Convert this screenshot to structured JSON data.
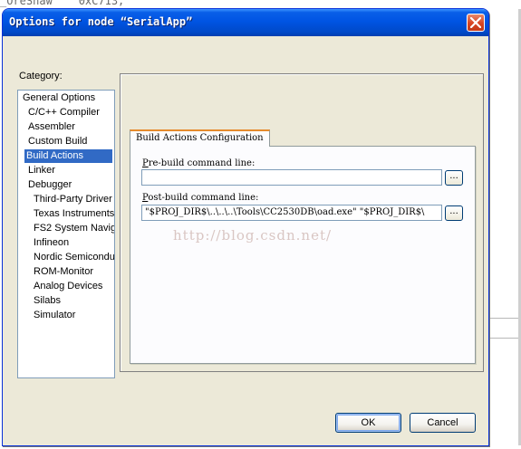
{
  "background": {
    "code_fragment": "_OreShaw    0xC713,"
  },
  "dialog": {
    "title": "Options for node “SerialApp”",
    "close_icon": "close-x-icon",
    "category_label": "Category:",
    "categories": [
      {
        "label": "General Options",
        "indent": 0,
        "selected": false
      },
      {
        "label": "C/C++ Compiler",
        "indent": 1,
        "selected": false
      },
      {
        "label": "Assembler",
        "indent": 1,
        "selected": false
      },
      {
        "label": "Custom Build",
        "indent": 1,
        "selected": false
      },
      {
        "label": "Build Actions",
        "indent": 1,
        "selected": true
      },
      {
        "label": "Linker",
        "indent": 1,
        "selected": false
      },
      {
        "label": "Debugger",
        "indent": 1,
        "selected": false
      },
      {
        "label": "Third-Party Driver",
        "indent": 2,
        "selected": false
      },
      {
        "label": "Texas Instruments",
        "indent": 2,
        "selected": false
      },
      {
        "label": "FS2 System Navig",
        "indent": 2,
        "selected": false
      },
      {
        "label": "Infineon",
        "indent": 2,
        "selected": false
      },
      {
        "label": "Nordic Semiconduc",
        "indent": 2,
        "selected": false
      },
      {
        "label": "ROM-Monitor",
        "indent": 2,
        "selected": false
      },
      {
        "label": "Analog Devices",
        "indent": 2,
        "selected": false
      },
      {
        "label": "Silabs",
        "indent": 2,
        "selected": false
      },
      {
        "label": "Simulator",
        "indent": 2,
        "selected": false
      }
    ],
    "tab_label": "Build Actions Configuration",
    "prebuild": {
      "label_accel": "P",
      "label_rest": "re-build command line:",
      "value": "",
      "browse_label": "..."
    },
    "postbuild": {
      "label_accel": "P",
      "label_rest": "ost-build command line:",
      "value": "\"$PROJ_DIR$\\..\\..\\..\\Tools\\CC2530DB\\oad.exe\" \"$PROJ_DIR$\\",
      "browse_label": "..."
    },
    "watermark": "http://blog.csdn.net/",
    "ok_label": "OK",
    "cancel_label": "Cancel"
  }
}
